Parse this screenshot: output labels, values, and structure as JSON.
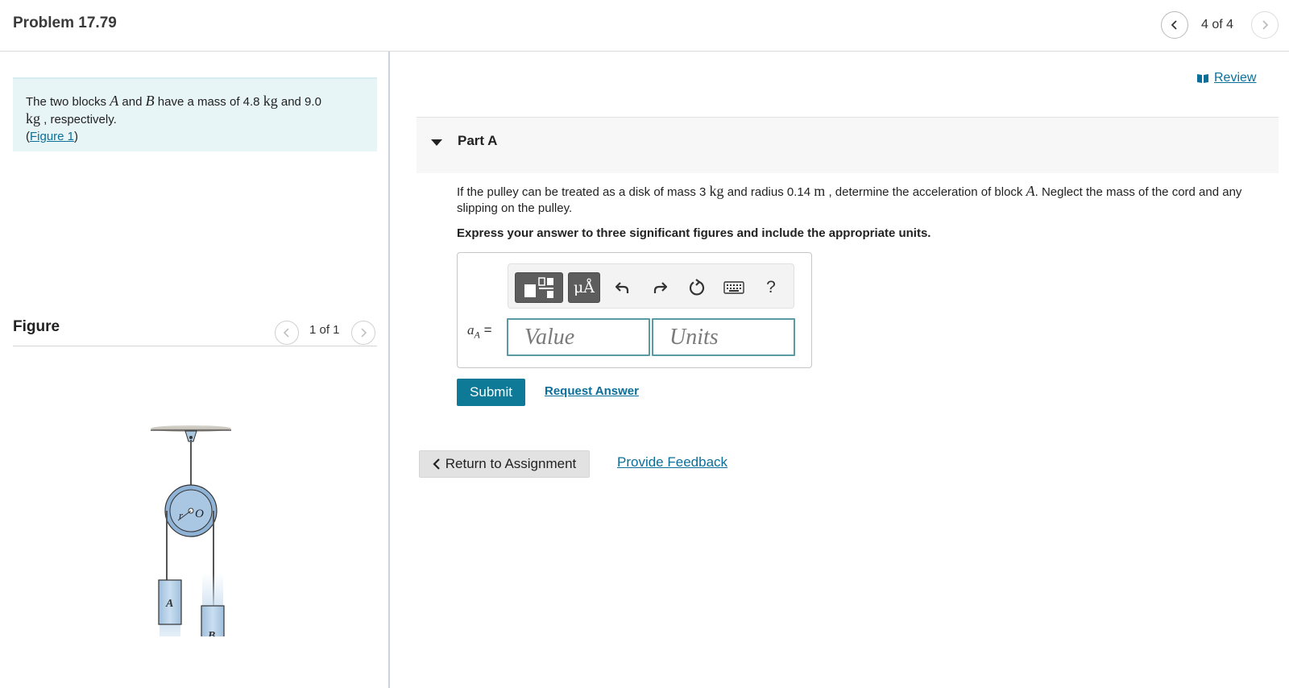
{
  "header": {
    "title": "Problem 17.79",
    "counter": "4 of 4"
  },
  "intro": {
    "text_1": "The two blocks",
    "var_a": "A",
    "text_2": "and",
    "var_b": "B",
    "text_3": "have a mass of 4.8",
    "unit_kg_1": "kg",
    "text_4": "and 9.0",
    "unit_kg_2": "kg",
    "text_5": ", respectively.",
    "figure_link": "Figure 1"
  },
  "figure_panel": {
    "label": "Figure",
    "counter": "1 of 1",
    "labels": {
      "radius": "r",
      "center": "O",
      "block_a": "A",
      "block_b": "B"
    }
  },
  "review": {
    "label": "Review",
    "icon": "book-icon"
  },
  "part": {
    "label": "Part A"
  },
  "question": {
    "text_1": "If the pulley can be treated as a disk of mass 3",
    "unit_kg": "kg",
    "text_2": "and radius 0.14",
    "unit_m": "m",
    "text_3": ", determine the acceleration of block",
    "var_a": "A",
    "text_4": ". Neglect the mass of the cord and any slipping on the pulley."
  },
  "instruction": "Express your answer to three significant figures and include the appropriate units.",
  "answer": {
    "var": "a",
    "sub": "A",
    "equals": "=",
    "value_placeholder": "Value",
    "units_placeholder": "Units",
    "toolbar": {
      "templates_icon": "templates-icon",
      "units_label": "μÅ",
      "undo_icon": "undo-icon",
      "redo_icon": "redo-icon",
      "reset_icon": "reset-icon",
      "keyboard_icon": "keyboard-icon",
      "help_label": "?"
    }
  },
  "actions": {
    "submit": "Submit",
    "request_answer": "Request Answer",
    "return": "Return to Assignment",
    "feedback": "Provide Feedback"
  },
  "colors": {
    "accent": "#0f7a97",
    "link": "#0b6f9a",
    "intro_bg": "#e8f5f7",
    "block_fill": "#b5d0e8"
  }
}
